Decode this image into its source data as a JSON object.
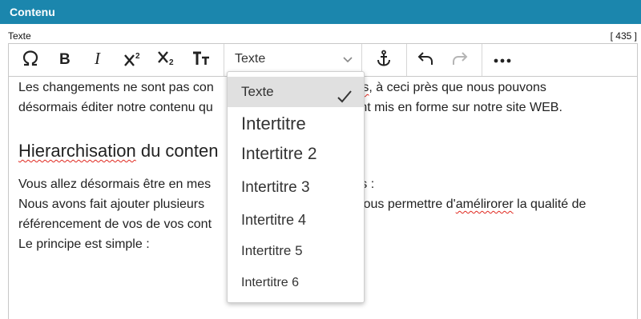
{
  "header": {
    "title": "Contenu"
  },
  "field": {
    "label": "Texte",
    "count": "[ 435 ]"
  },
  "toolbar": {
    "buttons": [
      {
        "name": "special-char",
        "icon": "omega-icon",
        "label": "Ω"
      },
      {
        "name": "bold",
        "icon": "bold-icon",
        "label": "B"
      },
      {
        "name": "italic",
        "icon": "italic-icon",
        "label": "I"
      },
      {
        "name": "superscript",
        "icon": "superscript-icon",
        "label": "X²"
      },
      {
        "name": "subscript",
        "icon": "subscript-icon",
        "label": "X₂"
      },
      {
        "name": "text-size",
        "icon": "text-size-icon",
        "label": "TT"
      },
      {
        "name": "anchor",
        "icon": "anchor-icon",
        "label": "⚓"
      },
      {
        "name": "undo",
        "icon": "undo-icon",
        "label": "↶"
      },
      {
        "name": "redo",
        "icon": "redo-icon",
        "label": "↷"
      },
      {
        "name": "more",
        "icon": "more-icon",
        "label": "•••"
      }
    ],
    "format_select": {
      "value": "Texte"
    }
  },
  "content": {
    "para1_line1_a": "Les changements ne sont pas con",
    "para1_line1_b": "aires",
    "para1_line1_c": ", à ceci près que nous pouvons",
    "para1_line2_a": "désormais éditer notre contenu qu",
    "para1_line2_b": "ctement mis en forme sur notre site WEB.",
    "heading_a": "Hierarchisation",
    "heading_b": " du conten",
    "para2_line1_a": "Vous allez désormais être en mes",
    "para2_line1_b": "s titres :",
    "para2_line2_a": "Nous avons fait ajouter plusieurs",
    "para2_line2_b": " vous permettre d'",
    "para2_line2_c": "amélirorer",
    "para2_line2_d": " la qualité de",
    "para2_line3": "référencement de vos de vos cont",
    "para2_line4": "Le principe est simple :"
  },
  "dropdown": {
    "items": [
      {
        "label": "Texte",
        "selected": true
      },
      {
        "label": "Intertitre",
        "selected": false
      },
      {
        "label": "Intertitre 2",
        "selected": false
      },
      {
        "label": "Intertitre 3",
        "selected": false
      },
      {
        "label": "Intertitre 4",
        "selected": false
      },
      {
        "label": "Intertitre 5",
        "selected": false
      },
      {
        "label": "Intertitre 6",
        "selected": false
      }
    ]
  },
  "colors": {
    "header_bg": "#1b86ad",
    "spellcheck": "#e0281f",
    "selected_bg": "#e0e0e0"
  }
}
